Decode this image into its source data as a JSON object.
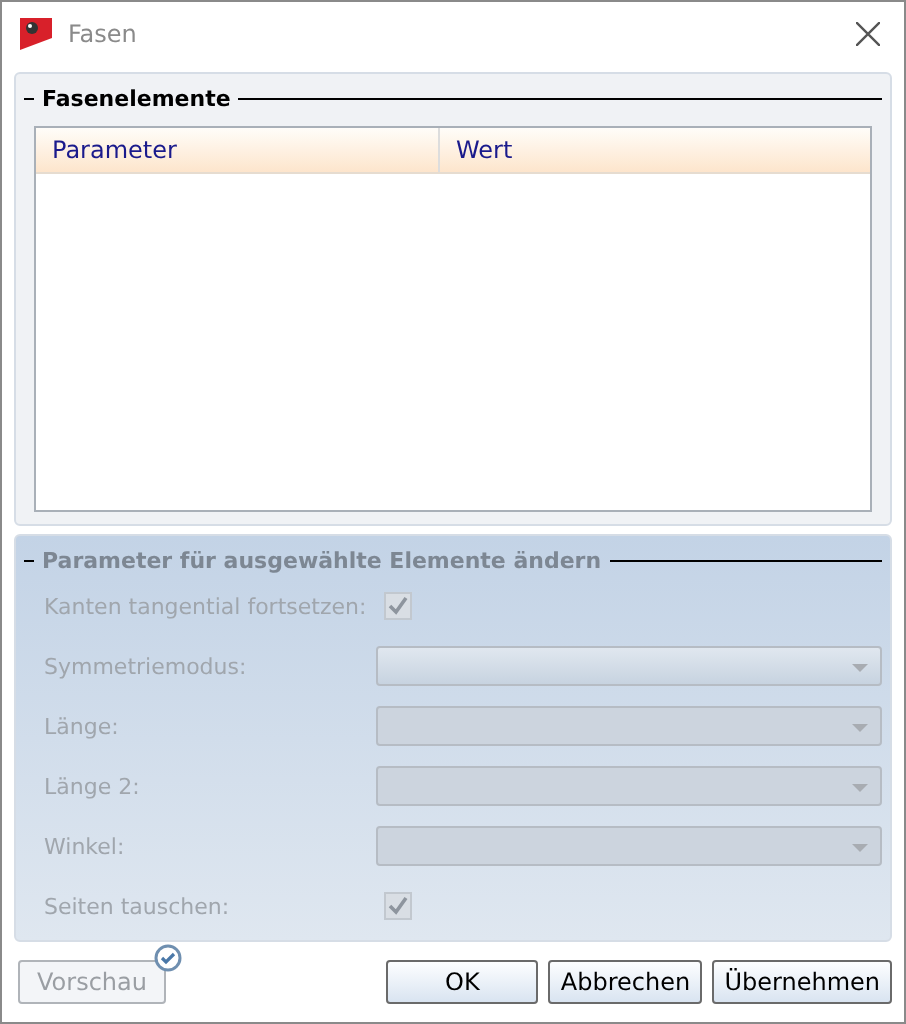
{
  "window": {
    "title": "Fasen"
  },
  "elements_group": {
    "title": "Fasenelemente",
    "table": {
      "columns": [
        "Parameter",
        "Wert"
      ]
    }
  },
  "parameters_group": {
    "title": "Parameter für ausgewählte Elemente ändern",
    "disabled": true,
    "rows": [
      {
        "kind": "checkbox",
        "label": "Kanten tangential fortsetzen:",
        "checked": true
      },
      {
        "kind": "dropdown",
        "label": "Symmetriemodus:"
      },
      {
        "kind": "dropdown",
        "label": "Länge:"
      },
      {
        "kind": "dropdown",
        "label": "Länge 2:"
      },
      {
        "kind": "dropdown",
        "label": "Winkel:"
      },
      {
        "kind": "checkbox",
        "label": "Seiten tauschen:",
        "checked": true
      }
    ]
  },
  "preview_button": {
    "label": "Vorschau",
    "disabled": true
  },
  "buttons": [
    "OK",
    "Abbrechen",
    "Übernehmen"
  ]
}
